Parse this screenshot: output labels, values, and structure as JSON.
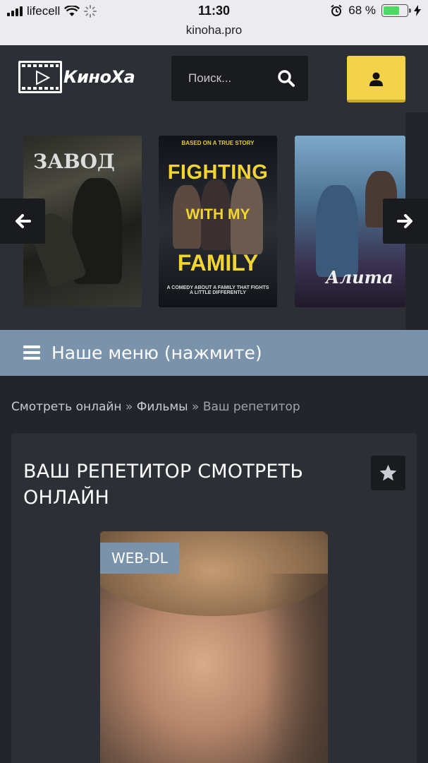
{
  "statusbar": {
    "carrier": "lifecell",
    "time": "11:30",
    "url": "kinoha.pro",
    "battery": "68 %",
    "battery_level": 0.68
  },
  "header": {
    "logo_text": "КиноХа",
    "search_placeholder": "Поиск...",
    "accent_color": "#f3d34a"
  },
  "carousel": {
    "posters": [
      {
        "title": "ЗАВОД"
      },
      {
        "top": "BASED ON A TRUE STORY",
        "l1": "FIGHTING",
        "l2": "WITH MY",
        "l3": "FAMILY",
        "bottom": "A COMEDY ABOUT A FAMILY THAT FIGHTS A LITTLE DIFFERENTLY"
      },
      {
        "title": "Алита"
      }
    ]
  },
  "menu": {
    "label": "Наше меню (нажмите)"
  },
  "breadcrumb": {
    "home": "Смотреть онлайн",
    "sep1": " » ",
    "section": "Фильмы",
    "sep2": " » ",
    "current": "Ваш репетитор"
  },
  "movie": {
    "title": "ВАШ РЕПЕТИТОР СМОТРЕТЬ ОНЛАЙН",
    "quality": "WEB-DL"
  }
}
